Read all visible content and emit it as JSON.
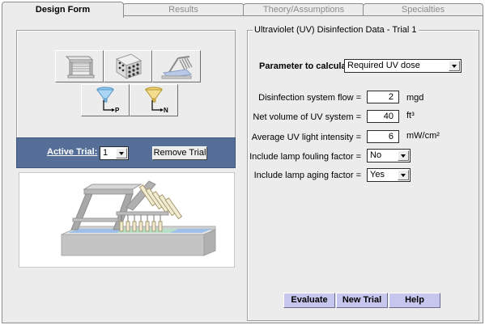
{
  "tabs": [
    {
      "label": "Design Form",
      "active": true
    },
    {
      "label": "Results",
      "active": false
    },
    {
      "label": "Theory/Assumptions",
      "active": false
    },
    {
      "label": "Specialties",
      "active": false
    }
  ],
  "icon_buttons": {
    "row1": [
      "reactor-frame-icon",
      "lamp-array-icon",
      "lamp-angle-icon"
    ],
    "row2": [
      {
        "icon": "funnel-p-icon",
        "letter": "P"
      },
      {
        "icon": "funnel-n-icon",
        "letter": "N"
      }
    ]
  },
  "trial": {
    "label": "Active Trial:",
    "value": "1",
    "remove_label": "Remove Trial"
  },
  "uv": {
    "title": "Ultraviolet (UV) Disinfection Data - Trial 1",
    "param_label": "Parameter to calculate:",
    "param_value": "Required UV dose",
    "fields": [
      {
        "label": "Disinfection system flow =",
        "value": "2",
        "unit": "mgd"
      },
      {
        "label": "Net volume of UV system =",
        "value": "40",
        "unit": "ft³"
      },
      {
        "label": "Average UV light intensity =",
        "value": "6",
        "unit": "mW/cm²"
      }
    ],
    "selects": [
      {
        "label": "Include lamp fouling factor =",
        "value": "No"
      },
      {
        "label": "Include lamp aging factor =",
        "value": "Yes"
      }
    ],
    "buttons": {
      "evaluate": "Evaluate",
      "new_trial": "New Trial",
      "help": "Help"
    }
  },
  "colors": {
    "trial_bar": "#556f99",
    "action_button": "#c6c6ee",
    "panel": "#ececec"
  }
}
